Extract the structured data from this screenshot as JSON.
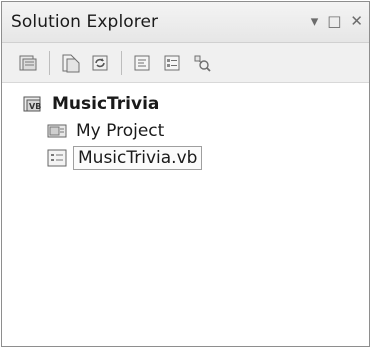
{
  "window": {
    "title": "Solution Explorer",
    "controls": {
      "dropdown": "▾",
      "maximize": "□",
      "close": "✕"
    }
  },
  "toolbar": {
    "buttons": [
      {
        "icon": "properties-icon"
      },
      {
        "icon": "show-all-files-icon"
      },
      {
        "icon": "refresh-icon"
      },
      {
        "icon": "view-code-icon"
      },
      {
        "icon": "view-designer-icon"
      },
      {
        "icon": "class-diagram-icon"
      }
    ]
  },
  "tree": {
    "project": {
      "label": "MusicTrivia",
      "icon": "vb-project-icon"
    },
    "items": [
      {
        "label": "My Project",
        "icon": "my-project-icon"
      },
      {
        "label": "MusicTrivia.vb",
        "icon": "code-file-icon",
        "selected": true
      }
    ]
  }
}
